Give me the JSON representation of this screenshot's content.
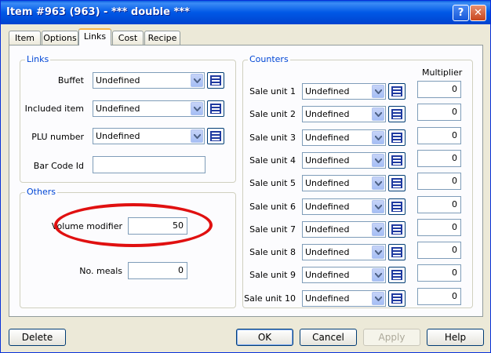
{
  "window": {
    "title": "Item #963 (963) - *** double ***"
  },
  "tabs": [
    "Item",
    "Options",
    "Links",
    "Cost",
    "Recipe"
  ],
  "active_tab": "Links",
  "links": {
    "title": "Links",
    "buffet": {
      "label": "Buffet",
      "value": "Undefined"
    },
    "included_item": {
      "label": "Included item",
      "value": "Undefined"
    },
    "plu_number": {
      "label": "PLU number",
      "value": "Undefined"
    },
    "bar_code": {
      "label": "Bar Code Id",
      "value": ""
    }
  },
  "others": {
    "title": "Others",
    "volume_modifier": {
      "label": "Volume modifier",
      "value": "50"
    },
    "no_meals": {
      "label": "No. meals",
      "value": "0"
    }
  },
  "counters": {
    "title": "Counters",
    "multiplier_header": "Multiplier",
    "rows": [
      {
        "label": "Sale unit 1",
        "value": "Undefined",
        "multiplier": "0"
      },
      {
        "label": "Sale unit 2",
        "value": "Undefined",
        "multiplier": "0"
      },
      {
        "label": "Sale unit 3",
        "value": "Undefined",
        "multiplier": "0"
      },
      {
        "label": "Sale unit 4",
        "value": "Undefined",
        "multiplier": "0"
      },
      {
        "label": "Sale unit 5",
        "value": "Undefined",
        "multiplier": "0"
      },
      {
        "label": "Sale unit 6",
        "value": "Undefined",
        "multiplier": "0"
      },
      {
        "label": "Sale unit 7",
        "value": "Undefined",
        "multiplier": "0"
      },
      {
        "label": "Sale unit 8",
        "value": "Undefined",
        "multiplier": "0"
      },
      {
        "label": "Sale unit 9",
        "value": "Undefined",
        "multiplier": "0"
      },
      {
        "label": "Sale unit 10",
        "value": "Undefined",
        "multiplier": "0"
      }
    ]
  },
  "buttons": {
    "delete": "Delete",
    "ok": "OK",
    "cancel": "Cancel",
    "apply": "Apply",
    "help": "Help"
  },
  "titlebar_buttons": {
    "help": "?",
    "close": "✕"
  },
  "colors": {
    "titlebar": "#0058e6",
    "groupbox_title": "#0046d5",
    "highlight": "#e01010",
    "tab_accent": "#f7b64b"
  }
}
